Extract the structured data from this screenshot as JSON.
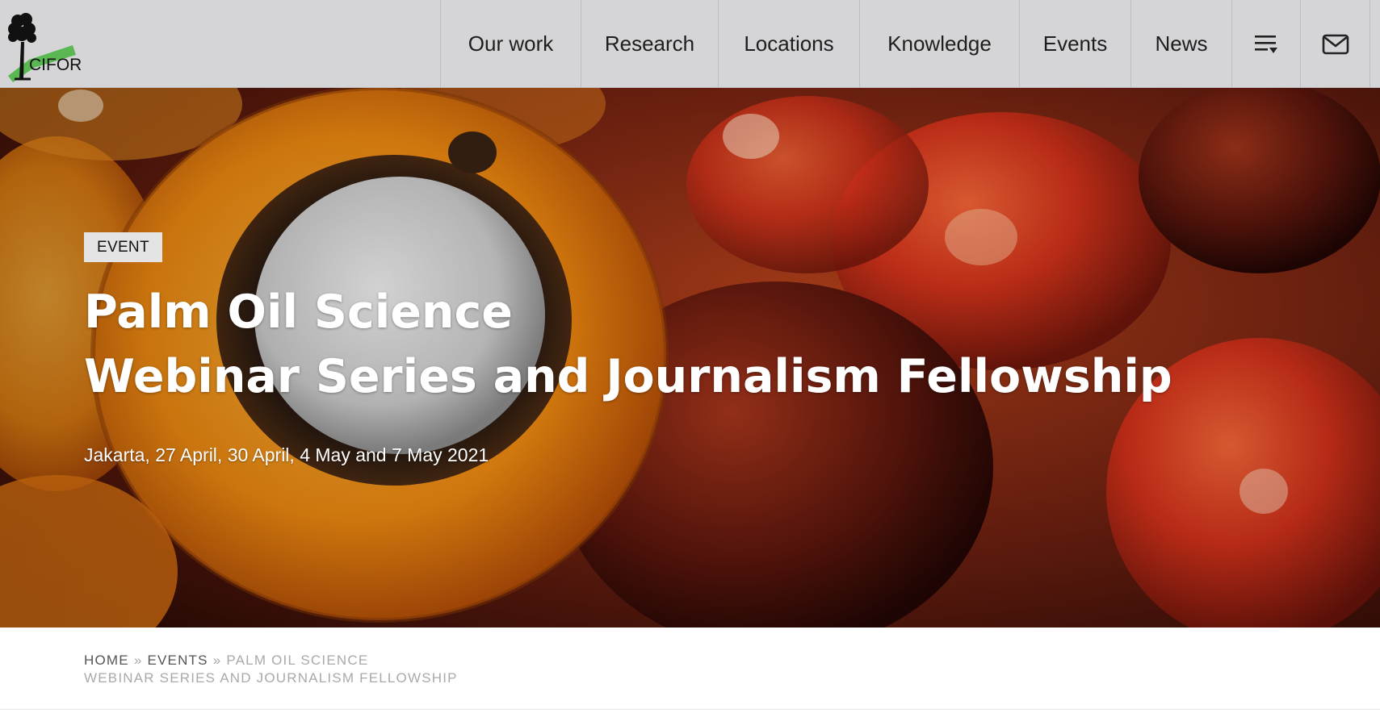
{
  "brand": {
    "logo_text": "CIFOR",
    "logo_green": "#4bb543"
  },
  "nav": {
    "items": [
      {
        "label": "Our work"
      },
      {
        "label": "Research"
      },
      {
        "label": "Locations"
      },
      {
        "label": "Knowledge"
      },
      {
        "label": "Events"
      },
      {
        "label": "News"
      }
    ],
    "menu_icon": "menu-list-dropdown-icon",
    "mail_icon": "envelope-icon"
  },
  "hero": {
    "badge": "EVENT",
    "title_line1": "Palm Oil Science",
    "title_line2": "Webinar Series and Journalism Fellowship",
    "date": "Jakarta, 27 April, 30 April, 4 May and 7 May 2021",
    "image_subject": "palm-oil-fruit-photo"
  },
  "breadcrumb": {
    "home": "HOME",
    "sep": "»",
    "events": "EVENTS",
    "current_line1": "PALM OIL SCIENCE",
    "current_line2": "WEBINAR SERIES AND JOURNALISM FELLOWSHIP"
  },
  "colors": {
    "header_bg": "#d5d5d7",
    "badge_bg": "#e4e4e4",
    "hero_text": "#ffffff"
  }
}
